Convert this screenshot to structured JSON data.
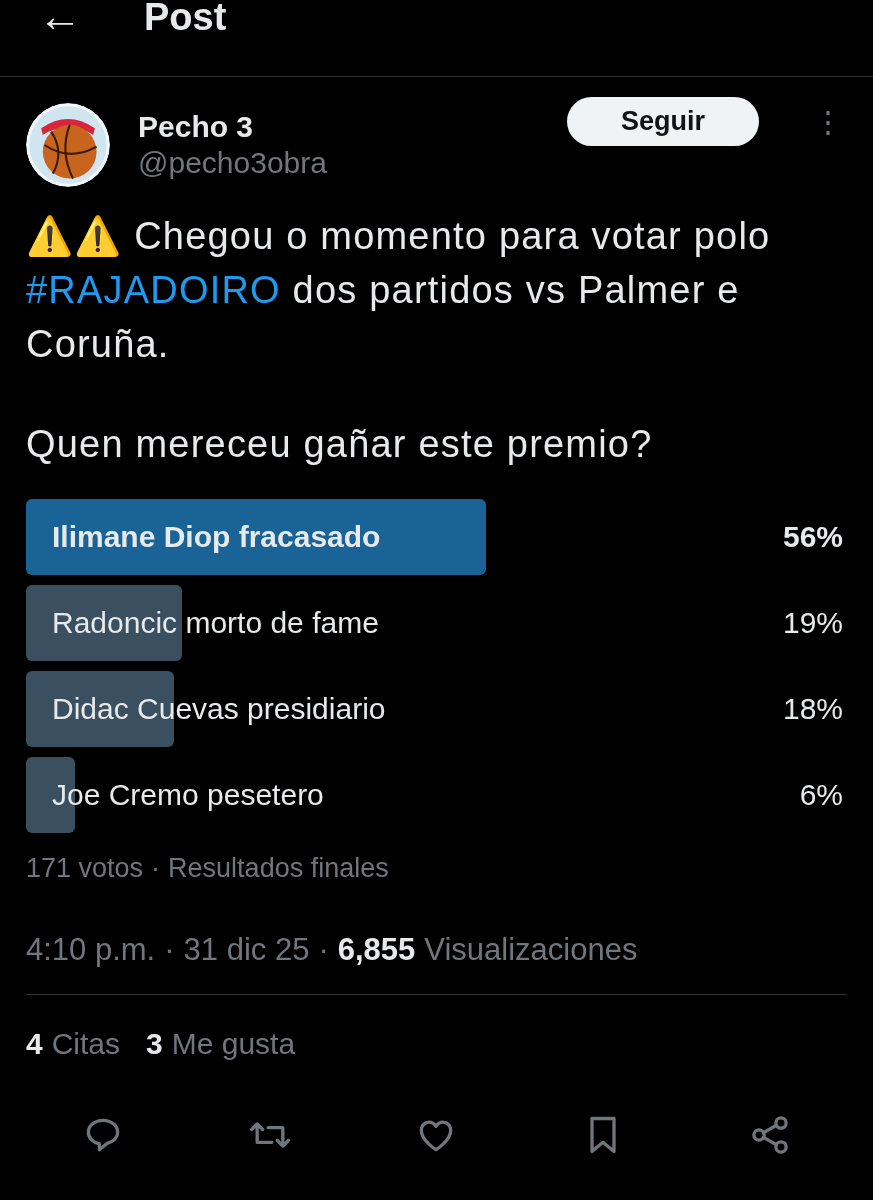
{
  "header": {
    "back": "←",
    "title": "Post"
  },
  "author": {
    "name": "Pecho 3",
    "handle": "@pecho3obra",
    "follow": "Seguir",
    "more": "⋮"
  },
  "text": [
    {
      "parts": [
        {
          "text": "⚠️⚠️ Chegou o momento para votar polo "
        },
        {
          "text": "#RAJADOIRO",
          "kind": "hashtag"
        },
        {
          "text": " dos partidos vs Palmer e Coruña."
        }
      ]
    },
    {
      "parts": [
        {
          "text": "Quen mereceu gañar este premio?"
        }
      ]
    }
  ],
  "poll": {
    "options": [
      {
        "label": "Ilimane Diop fracasado",
        "percent": "56%",
        "winner": true
      },
      {
        "label": "Radoncic morto de fame",
        "percent": "19%",
        "winner": false
      },
      {
        "label": "Didac Cuevas presidiario",
        "percent": "18%",
        "winner": false
      },
      {
        "label": "Joe Cremo pesetero",
        "percent": "6%",
        "winner": false
      }
    ],
    "votes": "171 votos",
    "separator": "·",
    "status": "Resultados finales"
  },
  "meta": {
    "time": "4:10 p.m.",
    "date": "31 dic 25",
    "views_count": "6,855",
    "views_label": "Visualizaciones",
    "separator": "·"
  },
  "stats": [
    {
      "count": "4",
      "label": "Citas"
    },
    {
      "count": "3",
      "label": "Me gusta"
    }
  ],
  "actions": [
    {
      "kind": "reply"
    },
    {
      "kind": "repost"
    },
    {
      "kind": "like"
    },
    {
      "kind": "bookmark"
    },
    {
      "kind": "share"
    }
  ]
}
